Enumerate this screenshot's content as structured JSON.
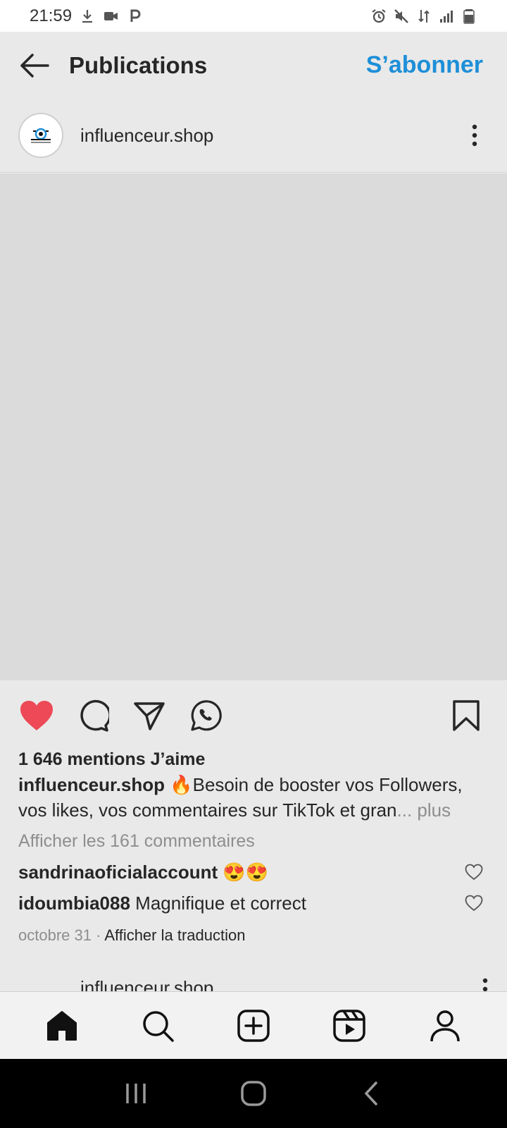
{
  "status_bar": {
    "time": "21:59",
    "icons_left": [
      "download-icon",
      "video-icon",
      "p-icon"
    ],
    "icons_right": [
      "alarm-icon",
      "mute-icon",
      "data-icon",
      "signal-icon",
      "battery-icon"
    ]
  },
  "top_bar": {
    "title": "Publications",
    "subscribe_label": "S’abonner"
  },
  "post": {
    "username": "influenceur.shop",
    "likes_text": "1 646 mentions J’aime",
    "caption_user": "influenceur.shop",
    "caption_text": " 🔥Besoin de booster vos Followers, vos likes, vos commentaires sur TikTok et gran",
    "caption_more": "... plus",
    "view_comments": "Afficher les 161 commentaires",
    "comments": [
      {
        "user": "sandrinaoficialaccount",
        "text": " 😍😍"
      },
      {
        "user": "idoumbia088",
        "text": " Magnifique et correct"
      }
    ],
    "date": "octobre 31",
    "separator": " · ",
    "translate": "Afficher la traduction"
  },
  "next_post": {
    "username": "influenceur.shop"
  },
  "colors": {
    "accent": "#1e8fd8",
    "like_red": "#ed4956"
  }
}
